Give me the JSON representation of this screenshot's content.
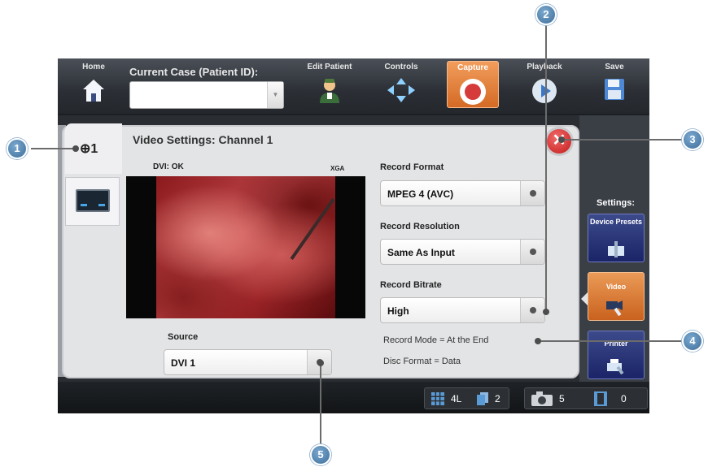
{
  "toolbar": {
    "home": "Home",
    "case_label": "Current Case (Patient ID):",
    "case_value": "",
    "edit_patient": "Edit Patient",
    "controls": "Controls",
    "capture": "Capture",
    "playback": "Playback",
    "save": "Save"
  },
  "panel": {
    "channel_label": "1",
    "title": "Video Settings:  Channel 1",
    "dvi_status": "DVI: OK",
    "resolution_badge": "XGA",
    "record_format_label": "Record Format",
    "record_format_value": "MPEG 4 (AVC)",
    "record_resolution_label": "Record Resolution",
    "record_resolution_value": "Same As Input",
    "record_bitrate_label": "Record Bitrate",
    "record_bitrate_value": "High",
    "record_mode": "Record Mode =  At the End",
    "disc_format": "Disc Format =  Data",
    "source_label": "Source",
    "source_value": "DVI 1"
  },
  "settings": {
    "label": "Settings:",
    "device_presets": "Device Presets",
    "video": "Video",
    "printer": "Printer"
  },
  "status": {
    "layout": "4L",
    "pages": "2",
    "photos": "5",
    "videos": "0"
  },
  "callouts": [
    "1",
    "2",
    "3",
    "4",
    "5"
  ],
  "colors": {
    "accent_orange": "#d46a25",
    "nav_blue": "#1a2466",
    "callout_blue": "#3e6f9a"
  }
}
